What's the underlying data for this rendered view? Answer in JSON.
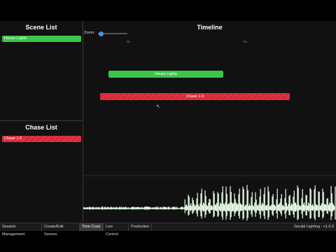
{
  "scene_list": {
    "title": "Scene List",
    "items": [
      {
        "label": "House Lights"
      }
    ]
  },
  "chase_list": {
    "title": "Chase List",
    "items": [
      {
        "label": "Chase 1.0"
      }
    ]
  },
  "timeline": {
    "title": "Timeline",
    "zoom_label": "Zoom:",
    "zoom_level": 0.1,
    "ticks": [
      "0s",
      "5s"
    ],
    "cues": [
      {
        "label": "House Lights",
        "color": "#3cc54a"
      },
      {
        "label": "Chase 1.0",
        "color": "#e0323f"
      }
    ]
  },
  "tabs": [
    {
      "label": "Session Management",
      "active": false
    },
    {
      "label": "Create/Edit Scenes",
      "active": false
    },
    {
      "label": "Time Cues",
      "active": true
    },
    {
      "label": "Live Control",
      "active": false
    },
    {
      "label": "Production",
      "active": false
    }
  ],
  "status": {
    "version": "Gerald Lighting - v1.0.0"
  }
}
